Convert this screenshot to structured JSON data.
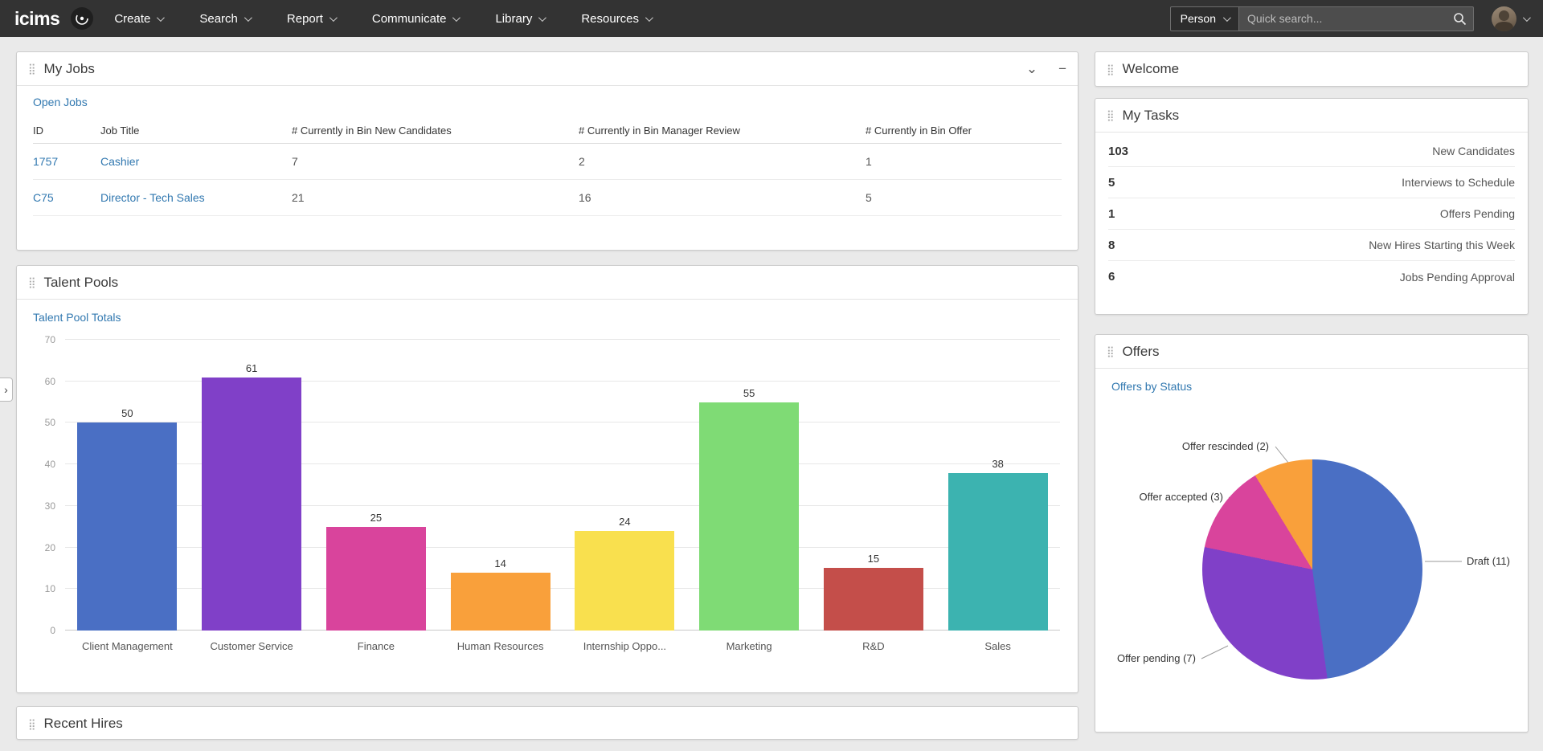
{
  "colors": {
    "navbar_bg": "#333333",
    "link_blue": "#3178b0",
    "page_bg": "#eaeaea"
  },
  "icons": {
    "drag_handle": "⣿",
    "chevron_down": "⌄",
    "minimize": "−",
    "expander_arrow": "›"
  },
  "navbar": {
    "logo": "icims",
    "menus": [
      {
        "label": "Create"
      },
      {
        "label": "Search"
      },
      {
        "label": "Report"
      },
      {
        "label": "Communicate"
      },
      {
        "label": "Library"
      },
      {
        "label": "Resources"
      }
    ],
    "search": {
      "scope": "Person",
      "placeholder": "Quick search..."
    }
  },
  "panels": {
    "my_jobs": {
      "title": "My Jobs",
      "link": "Open Jobs",
      "headers": [
        "ID",
        "Job Title",
        "# Currently in Bin New Candidates",
        "# Currently in Bin Manager Review",
        "# Currently in Bin Offer"
      ],
      "rows": [
        {
          "id": "1757",
          "title": "Cashier",
          "new_candidates": "7",
          "manager_review": "2",
          "offer": "1"
        },
        {
          "id": "C75",
          "title": "Director - Tech Sales",
          "new_candidates": "21",
          "manager_review": "16",
          "offer": "5"
        }
      ]
    },
    "talent_pools": {
      "title": "Talent Pools",
      "link": "Talent Pool Totals"
    },
    "recent_hires": {
      "title": "Recent Hires"
    },
    "welcome": {
      "title": "Welcome"
    },
    "my_tasks": {
      "title": "My Tasks",
      "items": [
        {
          "count": "103",
          "label": "New Candidates"
        },
        {
          "count": "5",
          "label": "Interviews to Schedule"
        },
        {
          "count": "1",
          "label": "Offers Pending"
        },
        {
          "count": "8",
          "label": "New Hires Starting this Week"
        },
        {
          "count": "6",
          "label": "Jobs Pending Approval"
        }
      ]
    },
    "offers": {
      "title": "Offers",
      "link": "Offers by Status"
    }
  },
  "chart_data": [
    {
      "type": "bar",
      "title": "Talent Pool Totals",
      "categories": [
        "Client Management",
        "Customer Service",
        "Finance",
        "Human Resources",
        "Internship Oppo...",
        "Marketing",
        "R&D",
        "Sales"
      ],
      "values": [
        50,
        61,
        25,
        14,
        24,
        55,
        15,
        38
      ],
      "colors": [
        "#4a6fc4",
        "#8040c8",
        "#d9449c",
        "#f9a03b",
        "#f9e04e",
        "#7fdb75",
        "#c44e4a",
        "#3cb3b0"
      ],
      "xlabel": "",
      "ylabel": "",
      "ylim": [
        0,
        70
      ],
      "ytick_step": 10,
      "grid": true,
      "legend": false
    },
    {
      "type": "pie",
      "title": "Offers by Status",
      "labels": [
        "Draft (11)",
        "Offer pending (7)",
        "Offer accepted (3)",
        "Offer rescinded (2)"
      ],
      "values": [
        11,
        7,
        3,
        2
      ],
      "colors": [
        "#4a6fc4",
        "#8040c8",
        "#d9449c",
        "#f9a03b"
      ],
      "legend": false
    }
  ],
  "edge_expander": "›"
}
